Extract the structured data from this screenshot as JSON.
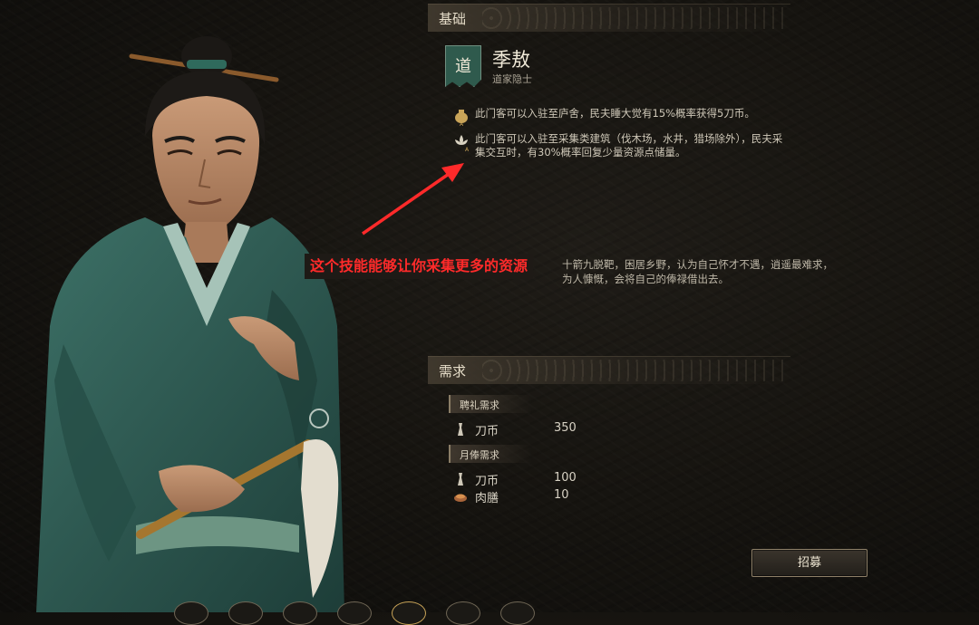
{
  "sections": {
    "basics_title": "基础",
    "requirements_title": "需求"
  },
  "character": {
    "emblem_char": "道",
    "name": "季敖",
    "title": "道家隐士"
  },
  "skills": [
    {
      "icon": "money-bag-icon",
      "text": "此门客可以入驻至庐舍，民夫睡大觉有15%概率获得5刀币。"
    },
    {
      "icon": "lotus-icon",
      "text": "此门客可以入驻至采集类建筑（伐木场，水井，猎场除外），民夫采集交互时，有30%概率回复少量资源点储量。"
    }
  ],
  "description": {
    "line1": "十箭九脱靶，困居乡野，认为自己怀才不遇，逍遥最难求，",
    "line2": "为人慷慨，会将自己的俸禄借出去。"
  },
  "annotation": {
    "text": "这个技能能够让你采集更多的资源",
    "color": "#ff2a2a"
  },
  "requirements": {
    "hire_label": "聘礼需求",
    "hire_items": [
      {
        "icon": "coin-icon",
        "name": "刀币",
        "value": "350"
      }
    ],
    "monthly_label": "月俸需求",
    "monthly_items": [
      {
        "icon": "coin-icon",
        "name": "刀币",
        "value": "100"
      },
      {
        "icon": "meat-bowl-icon",
        "name": "肉膳",
        "value": "10"
      }
    ]
  },
  "buttons": {
    "recruit": "招募"
  },
  "colors": {
    "accent": "#8e8068",
    "emblem": "#2f5a4d",
    "robe": "#2e5a52"
  }
}
